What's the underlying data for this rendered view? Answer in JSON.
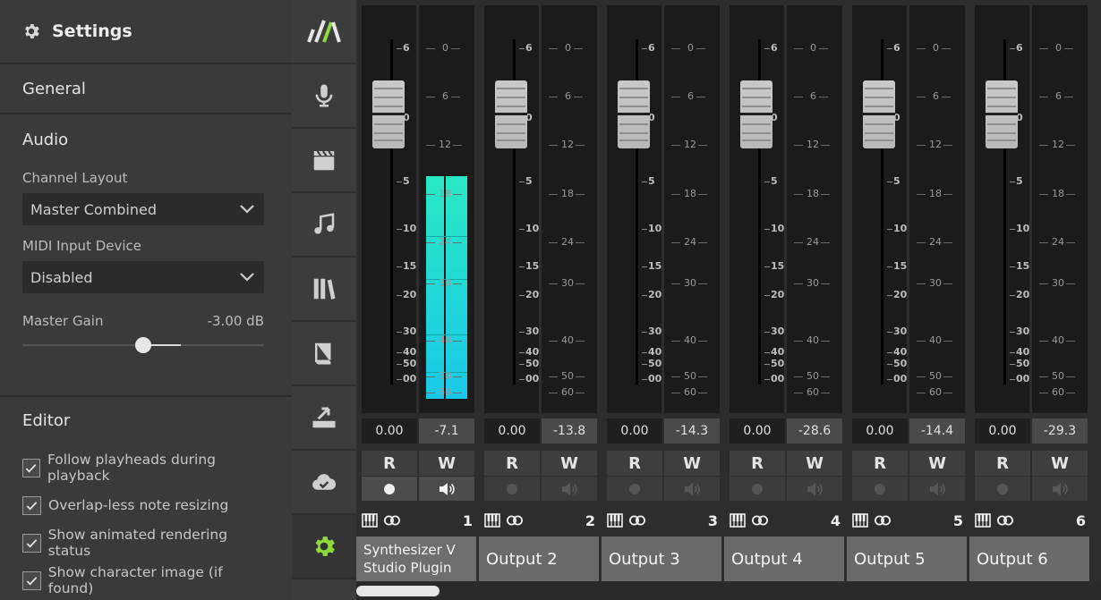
{
  "settings": {
    "title": "Settings",
    "general": "General",
    "audio": {
      "title": "Audio",
      "channel_layout_label": "Channel Layout",
      "channel_layout_value": "Master Combined",
      "midi_label": "MIDI Input Device",
      "midi_value": "Disabled",
      "gain_label": "Master Gain",
      "gain_value": "-3.00 dB",
      "gain_fraction": 0.5
    },
    "editor": {
      "title": "Editor",
      "options": [
        {
          "label": "Follow playheads during playback",
          "checked": true
        },
        {
          "label": "Overlap-less note resizing",
          "checked": true
        },
        {
          "label": "Show animated rendering status",
          "checked": true
        },
        {
          "label": "Show character image (if found)",
          "checked": true
        }
      ]
    }
  },
  "rail": {
    "items": [
      "logo-icon",
      "microphone-icon",
      "clapperboard-icon",
      "music-note-icon",
      "library-icon",
      "book-icon",
      "render-icon",
      "cloud-check-icon",
      "gear-icon"
    ],
    "active": "gear-icon",
    "accent": "#8ddc3c"
  },
  "mixer": {
    "fader_scale": [
      "6",
      "0",
      "5",
      "10",
      "15",
      "20",
      "30",
      "40",
      "50",
      "00"
    ],
    "meter_scale": [
      "0",
      "6",
      "12",
      "18",
      "24",
      "30",
      "40",
      "50",
      "60"
    ],
    "channels": [
      {
        "number": "1",
        "name_line1": "Synthesizer V",
        "name_line2": "Studio Plugin",
        "gain": "0.00",
        "peak": "-7.1",
        "record": "R",
        "write": "W",
        "active": true,
        "level": 0.55
      },
      {
        "number": "2",
        "name_line1": "Output 2",
        "name_line2": "",
        "gain": "0.00",
        "peak": "-13.8",
        "record": "R",
        "write": "W",
        "active": false,
        "level": 0
      },
      {
        "number": "3",
        "name_line1": "Output 3",
        "name_line2": "",
        "gain": "0.00",
        "peak": "-14.3",
        "record": "R",
        "write": "W",
        "active": false,
        "level": 0
      },
      {
        "number": "4",
        "name_line1": "Output 4",
        "name_line2": "",
        "gain": "0.00",
        "peak": "-28.6",
        "record": "R",
        "write": "W",
        "active": false,
        "level": 0
      },
      {
        "number": "5",
        "name_line1": "Output 5",
        "name_line2": "",
        "gain": "0.00",
        "peak": "-14.4",
        "record": "R",
        "write": "W",
        "active": false,
        "level": 0
      },
      {
        "number": "6",
        "name_line1": "Output 6",
        "name_line2": "",
        "gain": "0.00",
        "peak": "-29.3",
        "record": "R",
        "write": "W",
        "active": false,
        "level": 0
      }
    ]
  }
}
